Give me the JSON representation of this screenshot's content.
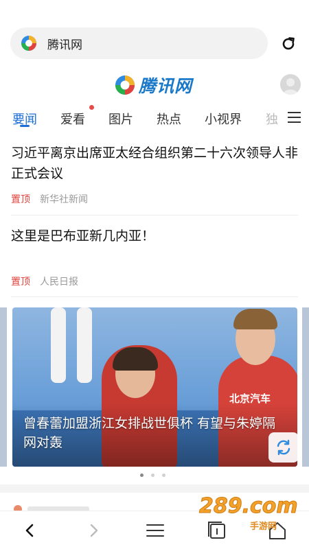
{
  "address_bar": {
    "text": "腾讯网",
    "reload_icon": "reload-icon"
  },
  "site": {
    "brand": "腾讯网",
    "brand_color": "#1a78c8"
  },
  "tabs": [
    {
      "label": "要闻",
      "active": true
    },
    {
      "label": "爱看",
      "badge": true
    },
    {
      "label": "图片"
    },
    {
      "label": "热点"
    },
    {
      "label": "小视界"
    },
    {
      "label": "独"
    }
  ],
  "news": [
    {
      "title": "习近平离京出席亚太经合组织第二十六次领导人非正式会议",
      "pin": "置顶",
      "source": "新华社新闻"
    },
    {
      "title": "这里是巴布亚新几内亚！",
      "pin": "置顶",
      "source": "人民日报"
    }
  ],
  "carousel": {
    "caption": "曾春蕾加盟浙江女排战世俱杯 有望与朱婷隔网对轰",
    "jersey_text": "北京汽车",
    "slides": 3,
    "active_slide": 1
  },
  "watermark": {
    "text": "289.com",
    "sub": "手游网"
  },
  "accent_color": "#1d6fd6",
  "pin_color": "#e0433d"
}
